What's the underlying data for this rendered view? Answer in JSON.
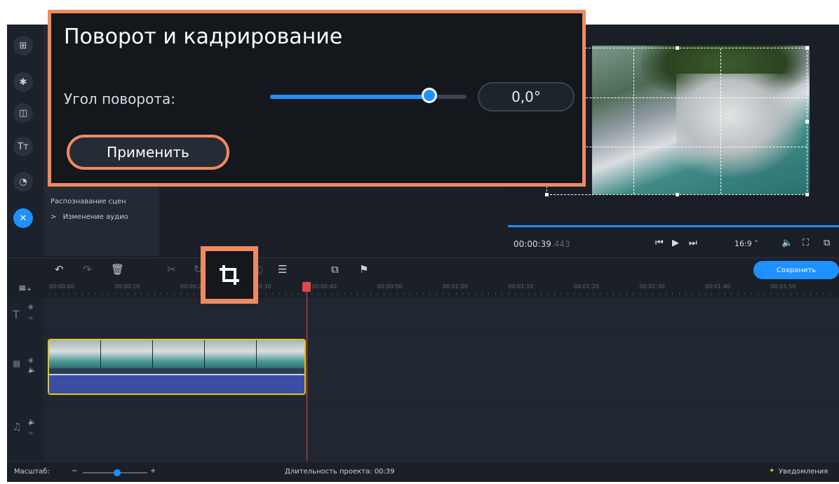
{
  "crop_dialog": {
    "title": "Поворот и кадрирование",
    "angle_label": "Угол поворота:",
    "angle_value": "0,0°",
    "slider_level_percent": 81,
    "apply_label": "Применить"
  },
  "tools_panel": {
    "items": [
      {
        "label": "Распознавание сцен"
      },
      {
        "label": "Изменение аудио",
        "prefix": ">"
      }
    ]
  },
  "player": {
    "time_main": "00:00:39",
    "time_ms": ".443",
    "aspect": "16:9",
    "aspect_arrow": "˅"
  },
  "timeline": {
    "save_label": "Сохранить",
    "ruler_ticks": [
      "00:00:00",
      "00:00:10",
      "00:00:20",
      "00:00:30",
      "00:00:40",
      "00:00:50",
      "00:01:00",
      "00:01:10",
      "00:01:20",
      "00:01:30",
      "00:01:40",
      "00:01:50"
    ]
  },
  "status_bar": {
    "zoom_label": "Масштаб:",
    "duration_text": "Длительность проекта: 00:39",
    "notifications_label": "Уведомления"
  },
  "icons": {
    "left_tools": [
      "import-icon",
      "magic-wand-icon",
      "transitions-icon",
      "titles-icon",
      "stickers-icon",
      "more-tools-icon"
    ],
    "toolbar": [
      "undo-icon",
      "redo-icon",
      "delete-icon",
      "cut-icon",
      "rotate-icon",
      "crop-icon",
      "color-adjust-icon",
      "properties-icon",
      "overlay-icon",
      "marker-icon"
    ]
  },
  "colors": {
    "accent": "#1e90ff",
    "highlight": "#ef8a5f",
    "playhead": "#e1474d",
    "clip_border": "#e7c21a"
  }
}
